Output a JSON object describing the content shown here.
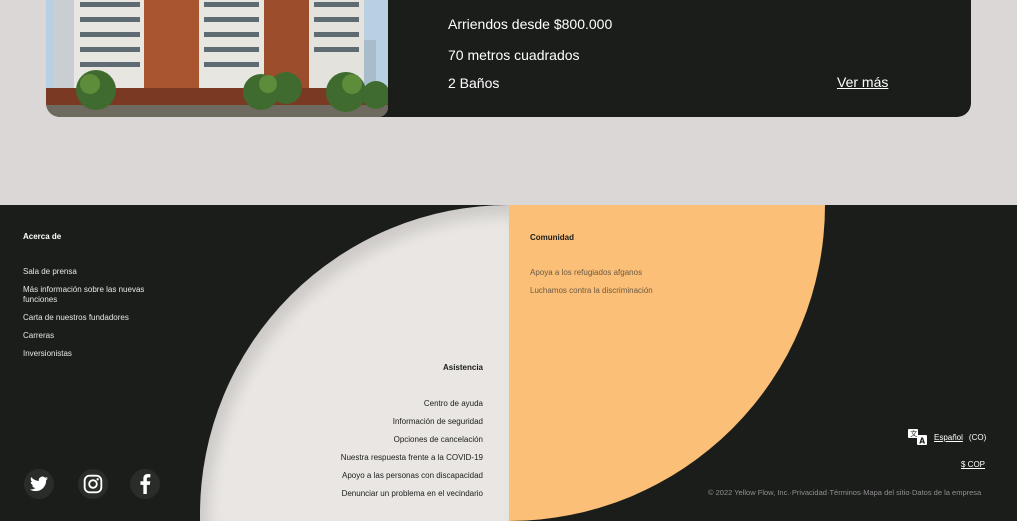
{
  "listing": {
    "price": "Arriendos desde $800.000",
    "area": "70 metros cuadrados",
    "baths": "2 Baños",
    "more_link": "Ver más"
  },
  "footer": {
    "about": {
      "title": "Acerca de",
      "links": [
        "Sala de prensa",
        "Más información sobre las nuevas",
        "funciones",
        "Carta de nuestros fundadores",
        "Carreras",
        "Inversionistas"
      ]
    },
    "help": {
      "title": "Asistencia",
      "links": [
        "Centro de ayuda",
        "Información de seguridad",
        "Opciones de cancelación",
        "Nuestra respuesta frente a la COVID-19",
        "Apoyo a las personas con discapacidad",
        "Denunciar un problema en el vecindario"
      ]
    },
    "community": {
      "title": "Comunidad",
      "links": [
        "Apoya a los refugiados afganos",
        "Luchamos contra la discriminación"
      ]
    },
    "social": {
      "icons": [
        "twitter-icon",
        "instagram-icon",
        "facebook-icon"
      ]
    },
    "language": {
      "label": "Español",
      "region": "(CO)",
      "icon": "translate-icon"
    },
    "currency": "$ COP",
    "legal": {
      "copyright": "© 2022 Yellow Flow, Inc.",
      "sep": "·",
      "links": [
        "Privacidad",
        "Términos",
        "Mapa del sitio",
        "Datos de la empresa"
      ]
    }
  },
  "colors": {
    "dark": "#1b1d1b",
    "light_bg": "#dbd7d6",
    "cream": "#e9e6e3",
    "orange": "#fbbf77"
  }
}
